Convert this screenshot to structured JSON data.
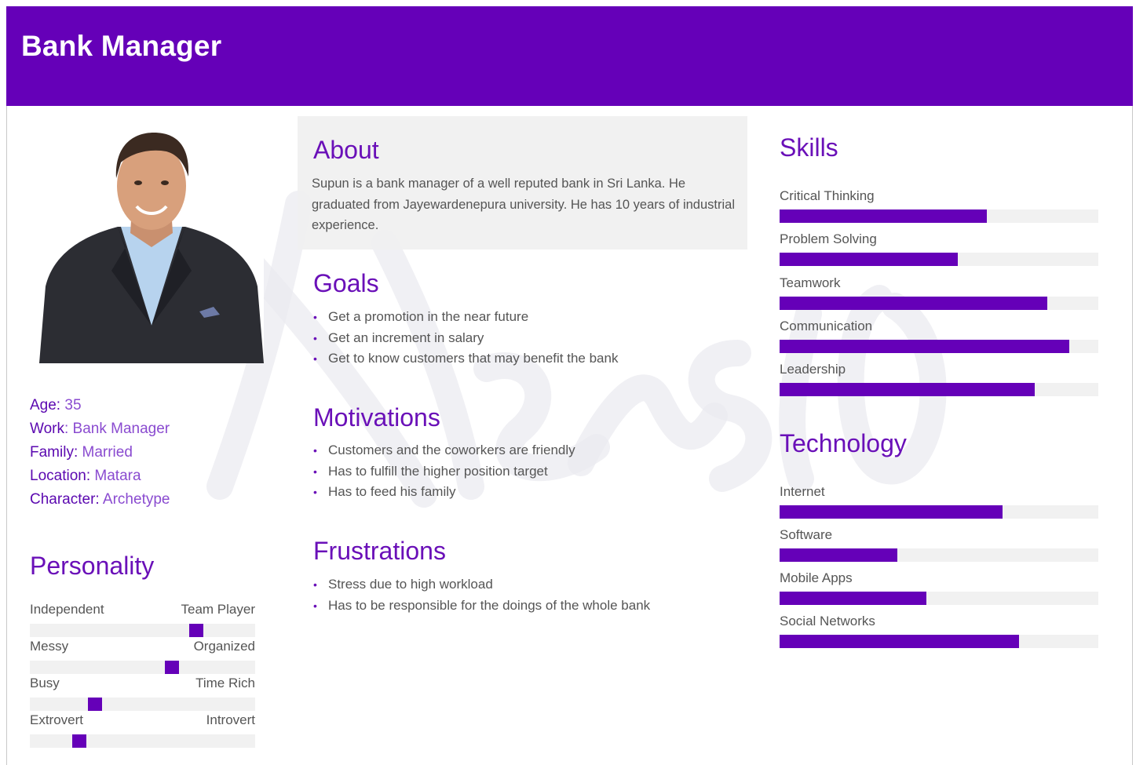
{
  "header": {
    "title": "Bank Manager"
  },
  "profile": {
    "fields": [
      {
        "key": "Age:",
        "value": " 35"
      },
      {
        "key": "Work",
        "value": ": Bank Manager"
      },
      {
        "key": "Family:",
        "value": " Married"
      },
      {
        "key": "Location:",
        "value": " Matara"
      },
      {
        "key": "Character:",
        "value": " Archetype"
      }
    ]
  },
  "personality": {
    "title": "Personality",
    "traits": [
      {
        "left": "Independent",
        "right": "Team Player",
        "level": 0.74
      },
      {
        "left": "Messy",
        "right": "Organized",
        "level": 0.63
      },
      {
        "left": "Busy",
        "right": "Time Rich",
        "level": 0.29
      },
      {
        "left": "Extrovert",
        "right": "Introvert",
        "level": 0.22
      }
    ]
  },
  "about": {
    "title": "About",
    "text": "Supun is a bank manager of a well reputed bank in Sri Lanka. He graduated from Jayewardenepura university. He has 10 years of industrial experience."
  },
  "goals": {
    "title": "Goals",
    "items": [
      "Get a promotion in the near future",
      "Get an increment in salary",
      "Get to know customers that may benefit the bank"
    ]
  },
  "motivations": {
    "title": "Motivations",
    "items": [
      "Customers and the coworkers are friendly",
      "Has to fulfill the higher position target",
      "Has to feed his family"
    ]
  },
  "frustrations": {
    "title": "Frustrations",
    "items": [
      "Stress due to high workload",
      "Has to be responsible for the doings of the whole bank"
    ]
  },
  "skills": {
    "title": "Skills",
    "items": [
      {
        "label": "Critical Thinking",
        "level": 0.65
      },
      {
        "label": "Problem Solving",
        "level": 0.56
      },
      {
        "label": "Teamwork",
        "level": 0.84
      },
      {
        "label": "Communication",
        "level": 0.91
      },
      {
        "label": "Leadership",
        "level": 0.8
      }
    ]
  },
  "technology": {
    "title": "Technology",
    "items": [
      {
        "label": "Internet",
        "level": 0.7
      },
      {
        "label": "Software",
        "level": 0.37
      },
      {
        "label": "Mobile Apps",
        "level": 0.46
      },
      {
        "label": "Social Networks",
        "level": 0.75
      }
    ]
  },
  "colors": {
    "accent": "#6500b8",
    "track": "#f1f1f1",
    "heading": "#6a10b8"
  }
}
